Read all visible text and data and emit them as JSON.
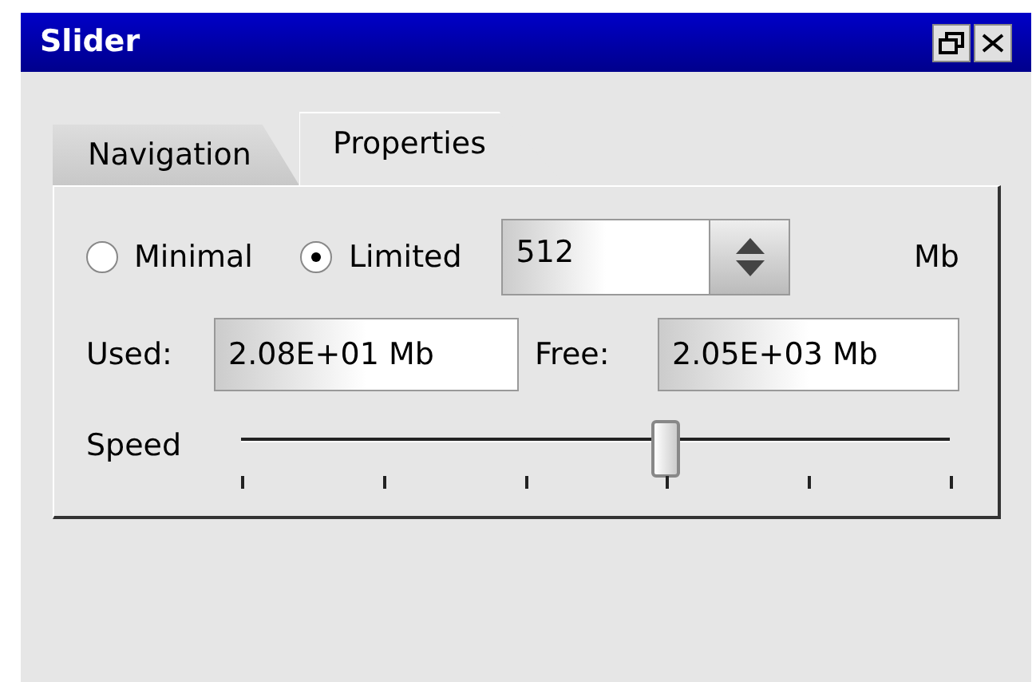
{
  "window": {
    "title": "Slider"
  },
  "tabs": [
    {
      "label": "Navigation",
      "selected": false
    },
    {
      "label": "Properties",
      "selected": true
    }
  ],
  "mode": [
    {
      "label": "Minimal",
      "selected": false
    },
    {
      "label": "Limited",
      "selected": true
    }
  ],
  "limit": {
    "value": "512",
    "unit": "Mb"
  },
  "used": {
    "label": "Used:",
    "value": "2.08E+01 Mb"
  },
  "free": {
    "label": "Free:",
    "value": "2.05E+03 Mb"
  },
  "speed": {
    "label": "Speed",
    "level": 0.6
  }
}
